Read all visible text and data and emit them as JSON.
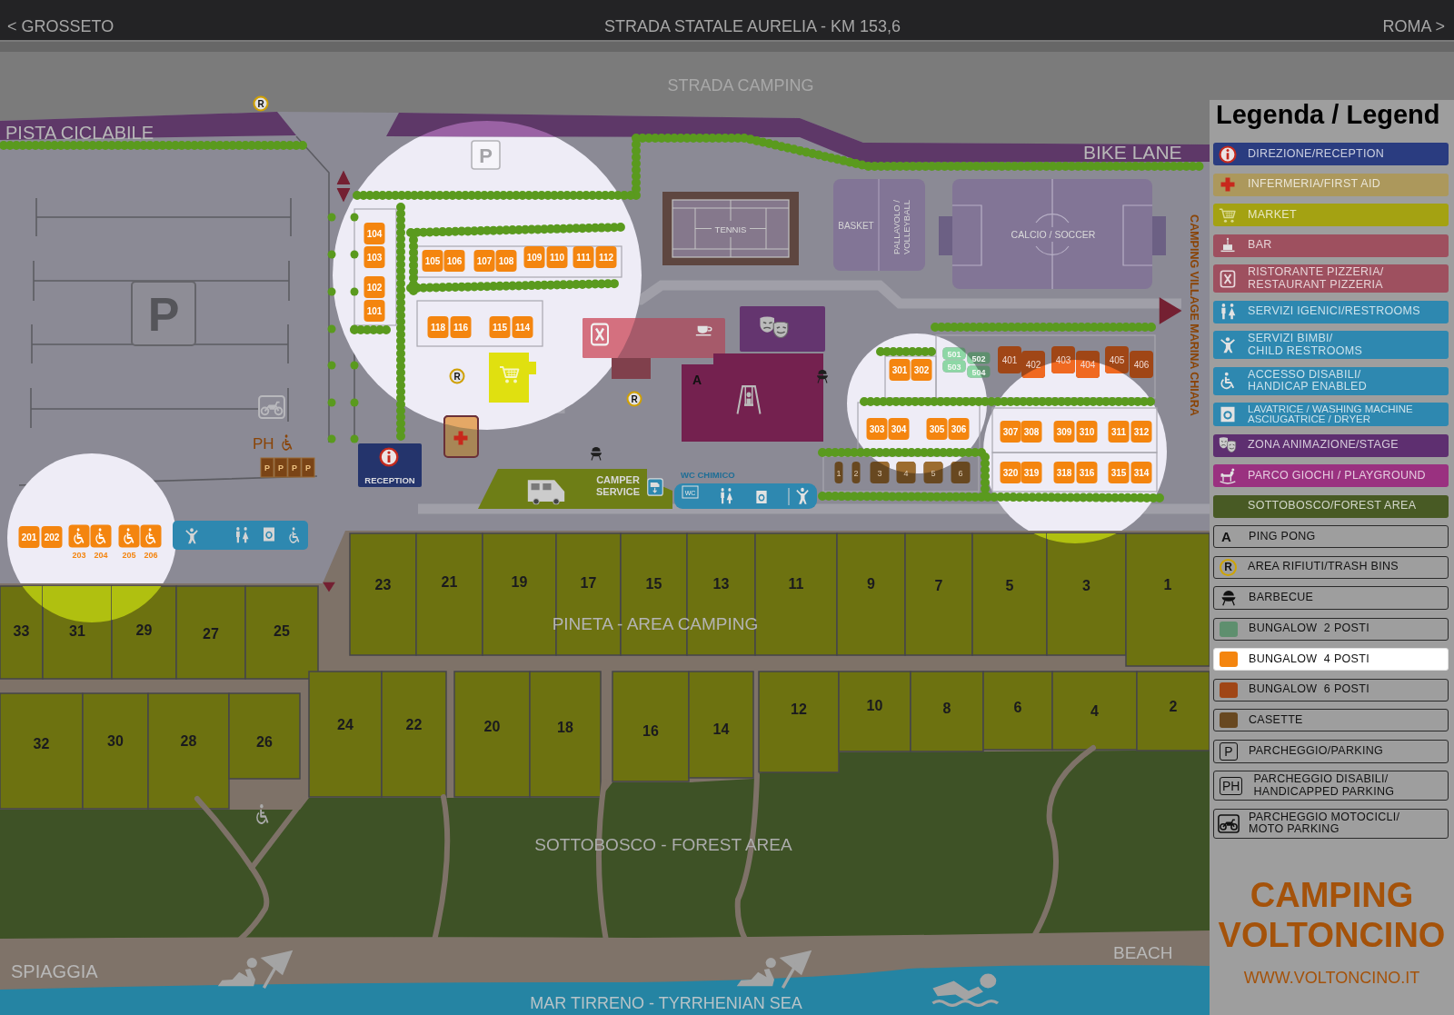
{
  "top_bar": {
    "left_label": "< GROSSETO",
    "title": "STRADA STATALE AURELIA - KM 153,6",
    "right_label": "ROMA >"
  },
  "map": {
    "road_label": "STRADA CAMPING",
    "bike_lane_labels": [
      "PISTA CICLABILE",
      "BIKE LANE"
    ],
    "neighbor_label": "CAMPING VILLAGE MARINA CHIARA",
    "sports": [
      {
        "kind": "tennis",
        "lines": [
          "TENNIS"
        ]
      },
      {
        "kind": "basket",
        "lines": [
          "BASKET"
        ]
      },
      {
        "kind": "volleyball",
        "lines": [
          "PALLAVOLO /",
          "VOLLEYBALL"
        ]
      },
      {
        "kind": "soccer",
        "lines": [
          "CALCIO / SOCCER"
        ]
      }
    ],
    "parking_signs": [
      "P",
      "P"
    ],
    "disabled_parking": {
      "label": "PH",
      "spots": [
        "P",
        "P",
        "P",
        "P"
      ]
    },
    "reception_label": "RECEPTION",
    "trash_bins": [
      "R",
      "R",
      "R"
    ],
    "ping_pong_mark": "A",
    "camper_service": [
      "CAMPER",
      "SERVICE"
    ],
    "chemical_wc": {
      "label": "WC CHIMICO",
      "sign": "WC"
    },
    "units": [
      {
        "number": "104",
        "kind": "bungalow4"
      },
      {
        "number": "103",
        "kind": "bungalow4"
      },
      {
        "number": "102",
        "kind": "bungalow4"
      },
      {
        "number": "101",
        "kind": "bungalow4"
      },
      {
        "number": "105",
        "kind": "bungalow4"
      },
      {
        "number": "106",
        "kind": "bungalow4"
      },
      {
        "number": "107",
        "kind": "bungalow4"
      },
      {
        "number": "108",
        "kind": "bungalow4"
      },
      {
        "number": "109",
        "kind": "bungalow4"
      },
      {
        "number": "110",
        "kind": "bungalow4"
      },
      {
        "number": "111",
        "kind": "bungalow4"
      },
      {
        "number": "112",
        "kind": "bungalow4"
      },
      {
        "number": "118",
        "kind": "bungalow4"
      },
      {
        "number": "116",
        "kind": "bungalow4"
      },
      {
        "number": "115",
        "kind": "bungalow4"
      },
      {
        "number": "114",
        "kind": "bungalow4"
      },
      {
        "number": "201",
        "kind": "bungalow4"
      },
      {
        "number": "202",
        "kind": "bungalow4"
      },
      {
        "number": "301",
        "kind": "bungalow4"
      },
      {
        "number": "302",
        "kind": "bungalow4"
      },
      {
        "number": "501",
        "kind": "bungalow2"
      },
      {
        "number": "502",
        "kind": "bungalow2"
      },
      {
        "number": "503",
        "kind": "bungalow2"
      },
      {
        "number": "504",
        "kind": "bungalow2"
      },
      {
        "number": "401",
        "kind": "bungalow6"
      },
      {
        "number": "402",
        "kind": "bungalow6"
      },
      {
        "number": "403",
        "kind": "bungalow6"
      },
      {
        "number": "404",
        "kind": "bungalow6"
      },
      {
        "number": "405",
        "kind": "bungalow6"
      },
      {
        "number": "406",
        "kind": "bungalow6"
      },
      {
        "number": "303",
        "kind": "bungalow4"
      },
      {
        "number": "304",
        "kind": "bungalow4"
      },
      {
        "number": "305",
        "kind": "bungalow4"
      },
      {
        "number": "306",
        "kind": "bungalow4"
      },
      {
        "number": "307",
        "kind": "bungalow4"
      },
      {
        "number": "308",
        "kind": "bungalow4"
      },
      {
        "number": "309",
        "kind": "bungalow4"
      },
      {
        "number": "310",
        "kind": "bungalow4"
      },
      {
        "number": "311",
        "kind": "bungalow4"
      },
      {
        "number": "312",
        "kind": "bungalow4"
      },
      {
        "number": "1",
        "kind": "casette"
      },
      {
        "number": "2",
        "kind": "casette"
      },
      {
        "number": "3",
        "kind": "casette"
      },
      {
        "number": "4",
        "kind": "casette"
      },
      {
        "number": "5",
        "kind": "casette"
      },
      {
        "number": "6",
        "kind": "casette"
      },
      {
        "number": "320",
        "kind": "bungalow4"
      },
      {
        "number": "319",
        "kind": "bungalow4"
      },
      {
        "number": "318",
        "kind": "bungalow4"
      },
      {
        "number": "316",
        "kind": "bungalow4"
      },
      {
        "number": "315",
        "kind": "bungalow4"
      },
      {
        "number": "314",
        "kind": "bungalow4"
      }
    ],
    "accessible_units": [
      {
        "number": "203",
        "kind": "bungalow4"
      },
      {
        "number": "204",
        "kind": "bungalow4"
      },
      {
        "number": "205",
        "kind": "bungalow4"
      },
      {
        "number": "206",
        "kind": "bungalow4"
      }
    ],
    "pitches": [
      "33",
      "31",
      "29",
      "27",
      "25",
      "23",
      "21",
      "19",
      "17",
      "15",
      "13",
      "11",
      "9",
      "7",
      "5",
      "3",
      "1",
      "32",
      "30",
      "28",
      "26",
      "24",
      "22",
      "20",
      "18",
      "16",
      "14",
      "12",
      "10",
      "8",
      "6",
      "4",
      "2"
    ],
    "area_labels": [
      {
        "kind": "pineta",
        "text": "PINETA - AREA CAMPING"
      },
      {
        "kind": "forest",
        "text": "SOTTOBOSCO - FOREST AREA"
      },
      {
        "kind": "spiaggia",
        "text": "SPIAGGIA"
      },
      {
        "kind": "beach",
        "text": "BEACH"
      },
      {
        "kind": "sea",
        "text": "MAR TIRRENO - TYRRHENIAN SEA"
      }
    ]
  },
  "legend": {
    "title": "Legenda / Legend",
    "items": [
      {
        "kind": "reception",
        "lines": [
          "DIREZIONE/RECEPTION"
        ],
        "color": "#2a3c80",
        "selected": false
      },
      {
        "kind": "firstaid",
        "lines": [
          "INFERMERIA/FIRST AID"
        ],
        "color": "#ac985c",
        "selected": false
      },
      {
        "kind": "market",
        "lines": [
          "MARKET"
        ],
        "color": "#a4a212",
        "selected": false
      },
      {
        "kind": "bar",
        "lines": [
          "BAR"
        ],
        "color": "#9e505f",
        "selected": false
      },
      {
        "kind": "restaurant",
        "lines": [
          "RISTORANTE PIZZERIA/",
          "RESTAURANT PIZZERIA"
        ],
        "color": "#9e505f",
        "selected": false
      },
      {
        "kind": "restrooms",
        "lines": [
          "SERVIZI IGENICI/RESTROOMS"
        ],
        "color": "#2e88b0",
        "selected": false
      },
      {
        "kind": "childrestrooms",
        "lines": [
          "SERVIZI BIMBI/",
          "CHILD RESTROOMS"
        ],
        "color": "#2e88b0",
        "selected": false
      },
      {
        "kind": "accessible",
        "lines": [
          "ACCESSO DISABILI/",
          "HANDICAP ENABLED"
        ],
        "color": "#2e88b0",
        "selected": false
      },
      {
        "kind": "laundry",
        "lines": [
          "LAVATRICE / WASHING MACHINE",
          "ASCIUGATRICE / DRYER"
        ],
        "color": "#2e88b0",
        "selected": false
      },
      {
        "kind": "stage",
        "lines": [
          "ZONA ANIMAZIONE/STAGE"
        ],
        "color": "#5e2f70",
        "selected": false
      },
      {
        "kind": "playground",
        "lines": [
          "PARCO GIOCHI / PLAYGROUND"
        ],
        "color": "#9a3180",
        "selected": false
      },
      {
        "kind": "forest",
        "lines": [
          "SOTTOBOSCO/FOREST AREA"
        ],
        "color": "#485a24",
        "selected": false
      },
      {
        "kind": "pingpong",
        "symbol": "A",
        "lines": [
          "PING PONG"
        ],
        "selected": false
      },
      {
        "kind": "trash",
        "symbol": "R",
        "lines": [
          "AREA RIFIUTI/TRASH BINS"
        ],
        "selected": false
      },
      {
        "kind": "barbecue",
        "lines": [
          "BARBECUE"
        ],
        "selected": false
      },
      {
        "kind": "bungalow2",
        "lines": [
          "BUNGALOW  2 POSTI"
        ],
        "color": "#5e8f6e",
        "selected": false
      },
      {
        "kind": "bungalow4",
        "lines": [
          "BUNGALOW  4 POSTI"
        ],
        "color": "#f4850f",
        "selected": true
      },
      {
        "kind": "bungalow6",
        "lines": [
          "BUNGALOW  6 POSTI"
        ],
        "color": "#a04616",
        "selected": false
      },
      {
        "kind": "casette",
        "lines": [
          "CASETTE"
        ],
        "color": "#684820",
        "selected": false
      },
      {
        "kind": "parking",
        "symbol": "P",
        "lines": [
          "PARCHEGGIO/PARKING"
        ],
        "selected": false
      },
      {
        "kind": "disabledparking",
        "symbol": "PH",
        "lines": [
          "PARCHEGGIO DISABILI/",
          "HANDICAPPED PARKING"
        ],
        "selected": false
      },
      {
        "kind": "motoparking",
        "lines": [
          "PARCHEGGIO MOTOCICLI/",
          "MOTO PARKING"
        ],
        "selected": false
      }
    ]
  },
  "brand": {
    "name_lines": [
      "CAMPING",
      "VOLTONCINO"
    ],
    "url": "WWW.VOLTONCINO.IT"
  }
}
